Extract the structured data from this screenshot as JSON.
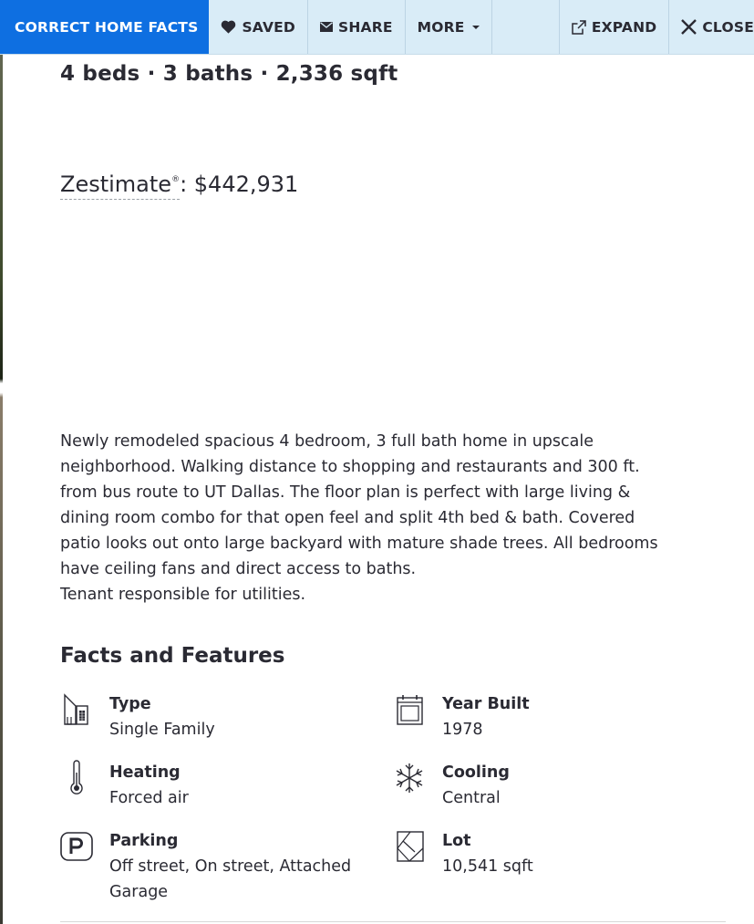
{
  "toolbar": {
    "correct_label": "CORRECT HOME FACTS",
    "saved_label": "SAVED",
    "share_label": "SHARE",
    "more_label": "MORE",
    "expand_label": "EXPAND",
    "close_label": "CLOSE",
    "primary_color": "#0e6fe1",
    "background_color": "#d9ecf7"
  },
  "listing": {
    "summary": "4 beds · 3 baths · 2,336 sqft",
    "zestimate_term": "Zestimate",
    "zestimate_mark": "®",
    "zestimate_value": ": $442,931",
    "description_lines": [
      "Newly remodeled spacious 4 bedroom, 3 full bath home in upscale",
      "neighborhood. Walking distance to shopping and restaurants and 300 ft.",
      "from bus route to UT Dallas. The floor plan is perfect with large living &",
      "dining room combo for that open feel and split 4th bed & bath. Covered",
      "patio looks out onto large backyard with mature shade trees. All bedrooms",
      "have ceiling fans and direct access to baths.",
      "Tenant responsible for utilities."
    ]
  },
  "facts": {
    "title": "Facts and Features",
    "items": [
      {
        "icon": "building-icon",
        "label": "Type",
        "value": "Single Family"
      },
      {
        "icon": "calendar-icon",
        "label": "Year Built",
        "value": "1978"
      },
      {
        "icon": "thermometer-icon",
        "label": "Heating",
        "value": "Forced air"
      },
      {
        "icon": "snowflake-icon",
        "label": "Cooling",
        "value": "Central"
      },
      {
        "icon": "parking-icon",
        "label": "Parking",
        "value": "Off street, On street, Attached Garage"
      },
      {
        "icon": "lot-icon",
        "label": "Lot",
        "value": "10,541 sqft"
      }
    ]
  }
}
